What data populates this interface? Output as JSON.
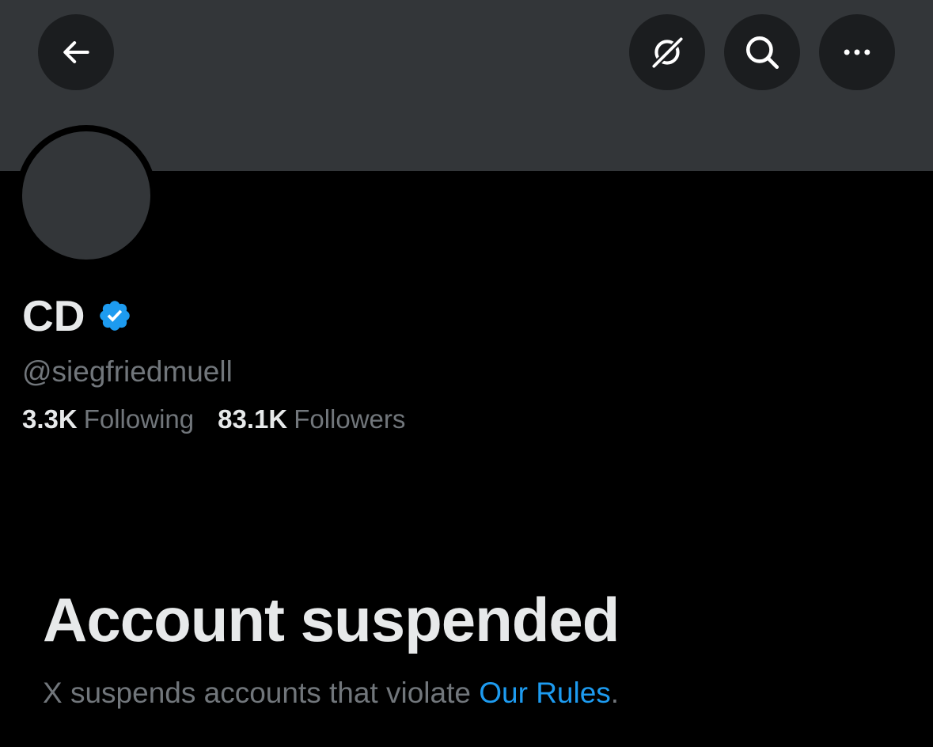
{
  "header": {
    "back_icon": "arrow-left-icon",
    "grok_icon": "grok-icon",
    "search_icon": "search-icon",
    "more_icon": "more-horizontal-icon"
  },
  "profile": {
    "display_name": "CD",
    "verified": true,
    "verified_color": "#1d9bf0",
    "handle": "@siegfriedmuell",
    "following_count": "3.3K",
    "following_label": "Following",
    "followers_count": "83.1K",
    "followers_label": "Followers"
  },
  "suspension": {
    "title": "Account suspended",
    "message": "X suspends accounts that violate ",
    "rules_link": "Our Rules",
    "period": "."
  },
  "colors": {
    "background": "#000000",
    "banner": "#333639",
    "button_bg": "#1b1d1f",
    "primary_text": "#e7e9ea",
    "secondary_text": "#71767b",
    "link": "#1d9bf0"
  }
}
